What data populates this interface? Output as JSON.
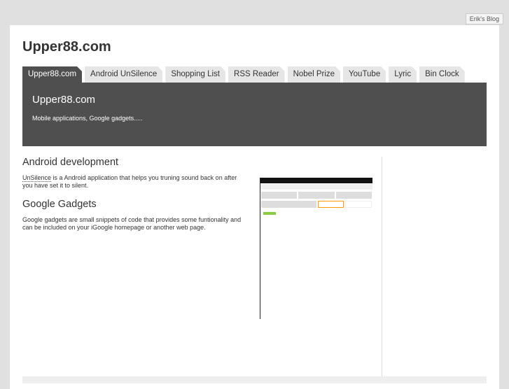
{
  "top_link": "Erik's Blog",
  "site_title": "Upper88.com",
  "tabs": [
    "Upper88.com",
    "Android UnSilence",
    "Shopping List",
    "RSS Reader",
    "Nobel Prize",
    "YouTube",
    "Lyric",
    "Bin Clock"
  ],
  "hero": {
    "title": "Upper88.com",
    "subtitle": "Mobile applications, Google gadgets....."
  },
  "sections": [
    {
      "heading": "Android development",
      "link": "UnSilence",
      "text": " is a Android application that helps you truning sound back on after you have set it to silent."
    },
    {
      "heading": "Google Gadgets",
      "text": "Google gadgets are small snippets of code that provides some funtionality and can be included on your iGoogle homepage or another web page."
    }
  ]
}
